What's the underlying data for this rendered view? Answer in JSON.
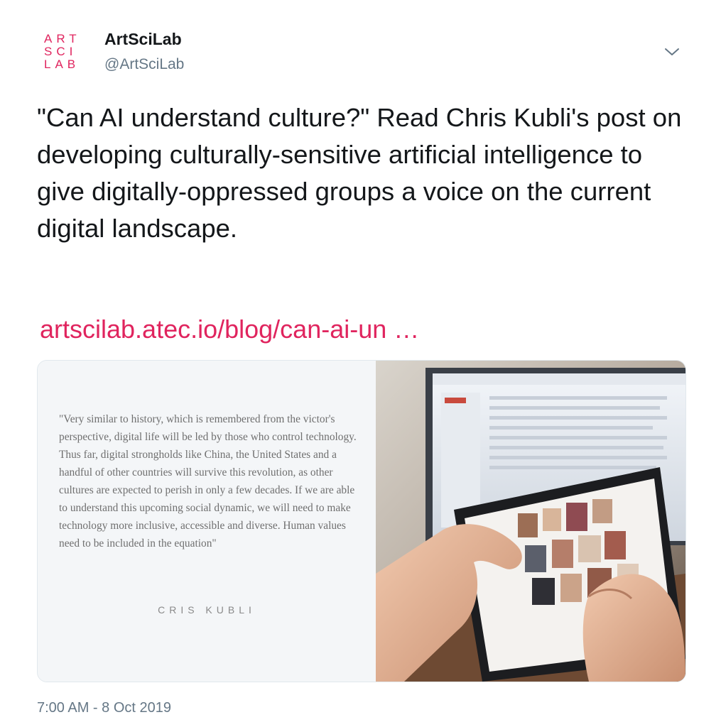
{
  "tweet": {
    "logo": {
      "line1": "ART",
      "line2": "SCI",
      "line3": "LAB"
    },
    "display_name": "ArtSciLab",
    "handle": "@ArtSciLab",
    "menu_icon": "chevron-down-icon",
    "text": "\"Can AI understand culture?\" Read Chris Kubli's post on developing culturally-sensitive artificial intelligence to give digitally-oppressed groups a voice on the current digital landscape.",
    "link": "artscilab.atec.io/blog/can-ai-un …",
    "timestamp": "7:00 AM - 8 Oct 2019"
  },
  "card": {
    "quote": "\"Very similar to history, which is remembered from the victor's perspective, digital life will be led by those who control technology. Thus far, digital strongholds like China, the United States and a handful of other countries will survive this revolution, as other cultures are expected to perish in only a few decades. If we are able to understand this upcoming social dynamic, we will need to make technology more inclusive, accessible and diverse. Human values need to be included in the equation\"",
    "author": "CRIS KUBLI",
    "photo": "hands-using-tablet-photo"
  },
  "colors": {
    "accent": "#e0245e",
    "text": "#14171a",
    "secondary": "#657786",
    "border": "#e1e8ed"
  }
}
